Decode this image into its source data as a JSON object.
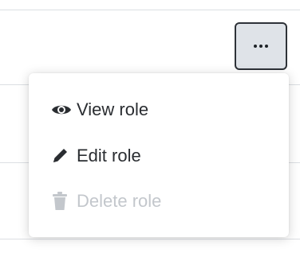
{
  "toolbar": {
    "more_button_icon": "ellipsis-icon"
  },
  "menu": {
    "items": [
      {
        "label": "View role",
        "icon": "eye-icon",
        "enabled": true
      },
      {
        "label": "Edit role",
        "icon": "pencil-icon",
        "enabled": true
      },
      {
        "label": "Delete role",
        "icon": "trash-icon",
        "enabled": false
      }
    ]
  },
  "colors": {
    "text": "#2a2d31",
    "disabled_text": "#c3c7cc",
    "button_bg": "#dfe3e8",
    "button_border": "#2e3238"
  }
}
